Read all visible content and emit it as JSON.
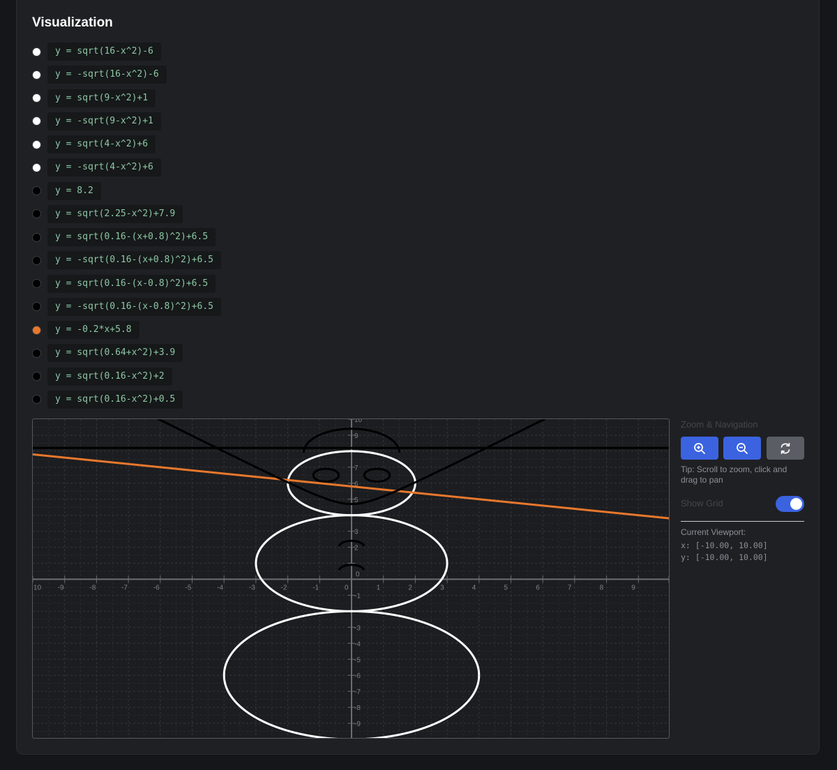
{
  "section_title": "Visualization",
  "equations": [
    {
      "expr": "y = sqrt(16-x^2)-6",
      "color": "#ffffff"
    },
    {
      "expr": "y = -sqrt(16-x^2)-6",
      "color": "#ffffff"
    },
    {
      "expr": "y = sqrt(9-x^2)+1",
      "color": "#ffffff"
    },
    {
      "expr": "y = -sqrt(9-x^2)+1",
      "color": "#ffffff"
    },
    {
      "expr": "y = sqrt(4-x^2)+6",
      "color": "#ffffff"
    },
    {
      "expr": "y = -sqrt(4-x^2)+6",
      "color": "#ffffff"
    },
    {
      "expr": "y = 8.2",
      "color": "#000000"
    },
    {
      "expr": "y = sqrt(2.25-x^2)+7.9",
      "color": "#000000"
    },
    {
      "expr": "y = sqrt(0.16-(x+0.8)^2)+6.5",
      "color": "#000000"
    },
    {
      "expr": "y = -sqrt(0.16-(x+0.8)^2)+6.5",
      "color": "#000000"
    },
    {
      "expr": "y = sqrt(0.16-(x-0.8)^2)+6.5",
      "color": "#000000"
    },
    {
      "expr": "y = -sqrt(0.16-(x-0.8)^2)+6.5",
      "color": "#000000"
    },
    {
      "expr": "y = -0.2*x+5.8",
      "color": "#e8782c"
    },
    {
      "expr": "y = sqrt(0.64+x^2)+3.9",
      "color": "#000000"
    },
    {
      "expr": "y = sqrt(0.16-x^2)+2",
      "color": "#000000"
    },
    {
      "expr": "y = sqrt(0.16-x^2)+0.5",
      "color": "#000000"
    }
  ],
  "chart_data": {
    "type": "line",
    "xlim": [
      -10,
      10
    ],
    "ylim": [
      -10,
      10
    ],
    "grid": true,
    "x_ticks": [
      "10",
      "-9",
      "-8",
      "-7",
      "-6",
      "-5",
      "-4",
      "-3",
      "-2",
      "-1",
      "0",
      "1",
      "2",
      "3",
      "4",
      "5",
      "6",
      "7",
      "8",
      "9"
    ],
    "y_ticks": [
      "-9",
      "-8",
      "-7",
      "-6",
      "-5",
      "-4",
      "-3",
      "-1",
      "2",
      "3",
      "5",
      "6",
      "7",
      "9",
      "10"
    ],
    "series": [
      {
        "expr": "y = sqrt(16-x^2)-6",
        "color": "#ffffff"
      },
      {
        "expr": "y = -sqrt(16-x^2)-6",
        "color": "#ffffff"
      },
      {
        "expr": "y = sqrt(9-x^2)+1",
        "color": "#ffffff"
      },
      {
        "expr": "y = -sqrt(9-x^2)+1",
        "color": "#ffffff"
      },
      {
        "expr": "y = sqrt(4-x^2)+6",
        "color": "#ffffff"
      },
      {
        "expr": "y = -sqrt(4-x^2)+6",
        "color": "#ffffff"
      },
      {
        "expr": "y = 8.2",
        "color": "#000000"
      },
      {
        "expr": "y = sqrt(2.25-x^2)+7.9",
        "color": "#000000"
      },
      {
        "expr": "y = sqrt(0.16-(x+0.8)^2)+6.5",
        "color": "#000000"
      },
      {
        "expr": "y = -sqrt(0.16-(x+0.8)^2)+6.5",
        "color": "#000000"
      },
      {
        "expr": "y = sqrt(0.16-(x-0.8)^2)+6.5",
        "color": "#000000"
      },
      {
        "expr": "y = -sqrt(0.16-(x-0.8)^2)+6.5",
        "color": "#000000"
      },
      {
        "expr": "y = -0.2*x+5.8",
        "color": "#e8782c"
      },
      {
        "expr": "y = sqrt(0.64+x^2)+3.9",
        "color": "#000000"
      },
      {
        "expr": "y = sqrt(0.16-x^2)+2",
        "color": "#000000"
      },
      {
        "expr": "y = sqrt(0.16-x^2)+0.5",
        "color": "#000000"
      }
    ]
  },
  "controls": {
    "heading": "Zoom & Navigation",
    "zoom_in_icon": "zoom-in-icon",
    "zoom_out_icon": "zoom-out-icon",
    "reset_icon": "refresh-icon",
    "tip": "Tip: Scroll to zoom, click and drag to pan",
    "show_grid_label": "Show Grid",
    "show_grid_on": true,
    "accent_color": "#3b63e0",
    "viewport_label": "Current Viewport:",
    "viewport_x": "x: [-10.00, 10.00]",
    "viewport_y": "y: [-10.00, 10.00]"
  }
}
